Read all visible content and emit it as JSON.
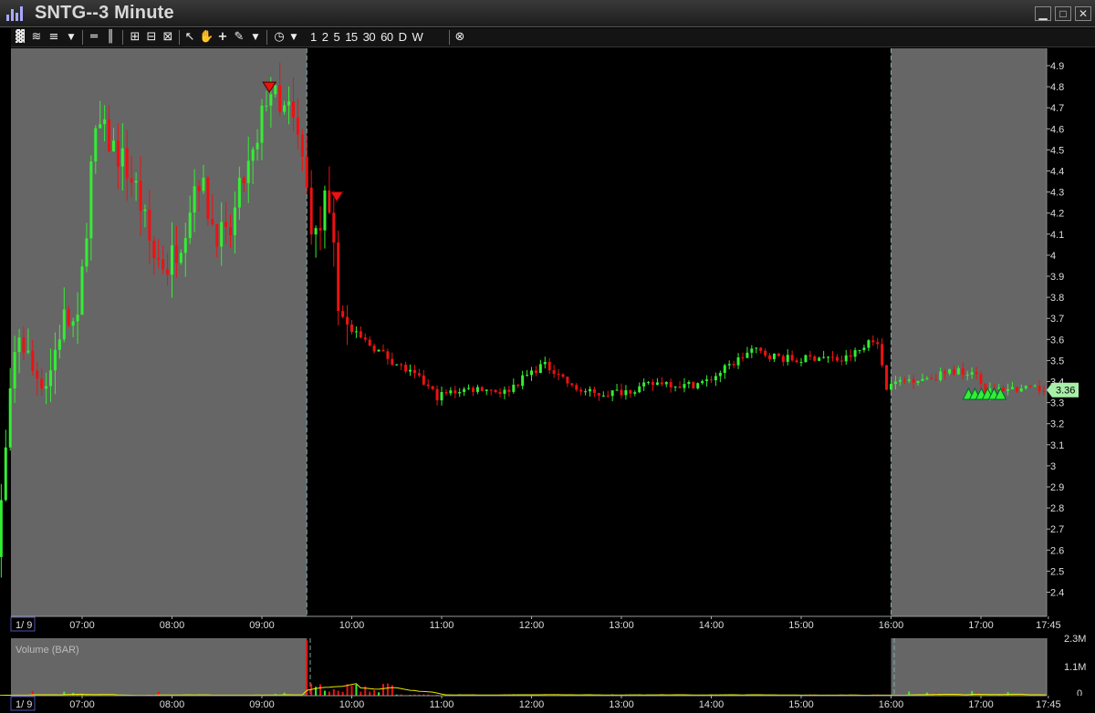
{
  "window": {
    "title": "SNTG--3 Minute",
    "buttons": {
      "minimize": "▁",
      "restore": "□",
      "close": "✕"
    }
  },
  "toolbar": {
    "timeframes": [
      "1",
      "2",
      "5",
      "15",
      "30",
      "60",
      "D",
      "W"
    ]
  },
  "price_axis": {
    "ticks": [
      "4.9",
      "4.8",
      "4.7",
      "4.6",
      "4.5",
      "4.4",
      "4.3",
      "4.2",
      "4.1",
      "4",
      "3.9",
      "3.8",
      "3.7",
      "3.6",
      "3.5",
      "3.4",
      "3.3",
      "3.2",
      "3.1",
      "3",
      "2.9",
      "2.8",
      "2.7",
      "2.6",
      "2.5",
      "2.4"
    ],
    "last_price": "3.36"
  },
  "time_axis": {
    "date_label": "1/ 9",
    "ticks": [
      "07:00",
      "08:00",
      "09:00",
      "10:00",
      "11:00",
      "12:00",
      "13:00",
      "14:00",
      "15:00",
      "16:00",
      "17:00",
      "17:45"
    ]
  },
  "volume_panel": {
    "title": "Volume (BAR)",
    "ticks": [
      "2.3M",
      "1.1M",
      "0"
    ]
  },
  "colors": {
    "up": "#33ee33",
    "down": "#ee1111",
    "extended_hours_bg": "#666666",
    "regular_hours_bg": "#000000",
    "session_divider": "#7fa9a9",
    "volume_average": "#e8e800",
    "last_price_tag": "#a8f0a8"
  },
  "chart_data": {
    "type": "candlestick",
    "symbol": "SNTG",
    "interval": "3 Minute",
    "price_range": [
      2.35,
      4.95
    ],
    "sessions": {
      "premarket_end": "09:30",
      "regular_end": "16:00"
    },
    "price_path": [
      [
        "06:00",
        2.4
      ],
      [
        "06:05",
        2.48
      ],
      [
        "06:15",
        3.3
      ],
      [
        "06:20",
        3.65
      ],
      [
        "06:30",
        3.45
      ],
      [
        "06:40",
        3.4
      ],
      [
        "06:50",
        3.7
      ],
      [
        "07:00",
        3.65
      ],
      [
        "07:10",
        4.5
      ],
      [
        "07:15",
        4.6
      ],
      [
        "07:20",
        4.55
      ],
      [
        "07:30",
        4.45
      ],
      [
        "07:40",
        4.3
      ],
      [
        "07:50",
        4.0
      ],
      [
        "08:00",
        3.95
      ],
      [
        "08:10",
        4.1
      ],
      [
        "08:20",
        4.4
      ],
      [
        "08:30",
        4.15
      ],
      [
        "08:40",
        4.05
      ],
      [
        "08:50",
        4.35
      ],
      [
        "09:00",
        4.5
      ],
      [
        "09:05",
        4.75
      ],
      [
        "09:10",
        4.8
      ],
      [
        "09:15",
        4.65
      ],
      [
        "09:20",
        4.7
      ],
      [
        "09:25",
        4.6
      ],
      [
        "09:30",
        4.45
      ],
      [
        "09:35",
        4.2
      ],
      [
        "09:40",
        4.05
      ],
      [
        "09:45",
        4.25
      ],
      [
        "09:50",
        4.05
      ],
      [
        "09:55",
        3.75
      ],
      [
        "10:00",
        3.65
      ],
      [
        "10:10",
        3.6
      ],
      [
        "10:20",
        3.55
      ],
      [
        "10:30",
        3.5
      ],
      [
        "10:40",
        3.45
      ],
      [
        "10:50",
        3.4
      ],
      [
        "11:00",
        3.33
      ],
      [
        "11:15",
        3.36
      ],
      [
        "11:30",
        3.37
      ],
      [
        "11:45",
        3.35
      ],
      [
        "12:00",
        3.43
      ],
      [
        "12:10",
        3.48
      ],
      [
        "12:20",
        3.45
      ],
      [
        "12:30",
        3.37
      ],
      [
        "12:45",
        3.34
      ],
      [
        "13:00",
        3.35
      ],
      [
        "13:15",
        3.37
      ],
      [
        "13:30",
        3.4
      ],
      [
        "13:45",
        3.38
      ],
      [
        "14:00",
        3.4
      ],
      [
        "14:10",
        3.45
      ],
      [
        "14:20",
        3.5
      ],
      [
        "14:30",
        3.55
      ],
      [
        "14:45",
        3.52
      ],
      [
        "15:00",
        3.5
      ],
      [
        "15:15",
        3.52
      ],
      [
        "15:30",
        3.5
      ],
      [
        "15:45",
        3.56
      ],
      [
        "15:50",
        3.62
      ],
      [
        "15:55",
        3.55
      ],
      [
        "16:00",
        3.38
      ],
      [
        "16:15",
        3.41
      ],
      [
        "16:30",
        3.42
      ],
      [
        "16:45",
        3.45
      ],
      [
        "17:00",
        3.45
      ],
      [
        "17:05",
        3.35
      ],
      [
        "17:20",
        3.37
      ],
      [
        "17:35",
        3.36
      ],
      [
        "17:45",
        3.36
      ]
    ],
    "signal_markers": [
      {
        "type": "sell",
        "time": "09:05",
        "price": 4.8
      },
      {
        "type": "sell",
        "time": "09:50",
        "price": 4.28
      },
      {
        "type": "buy",
        "time": "17:10",
        "price": 3.35
      }
    ],
    "volume_range": [
      0,
      2300000
    ]
  }
}
